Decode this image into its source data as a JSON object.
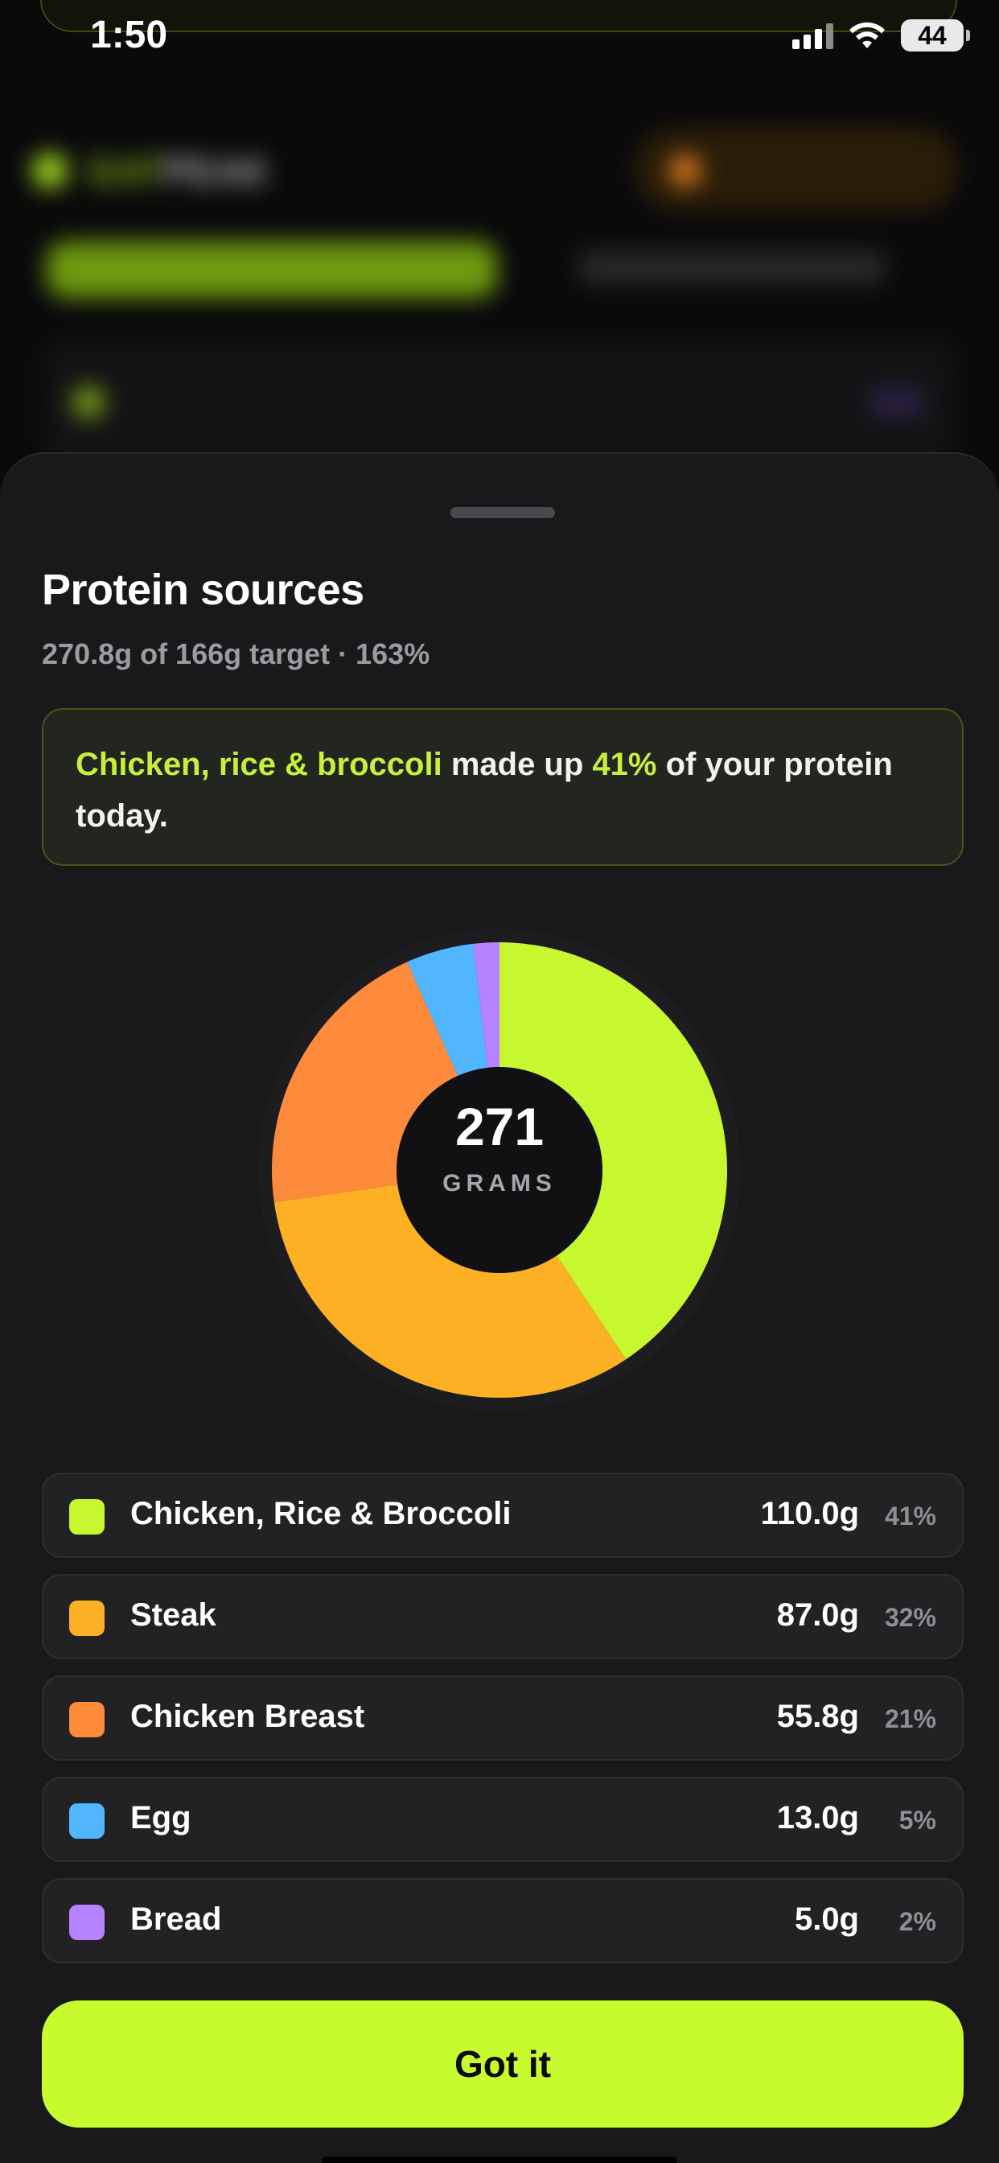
{
  "status_bar": {
    "time": "1:50",
    "battery": "44"
  },
  "background_app": {
    "logo_primary": "EAT",
    "logo_secondary": "PEAK"
  },
  "sheet": {
    "title": "Protein sources",
    "subtitle": "270.8g of 166g target · 163%",
    "insight": {
      "highlight_food": "Chicken, rice & broccoli",
      "text_mid": " made up ",
      "highlight_pct": "41%",
      "text_end": " of your protein today."
    },
    "donut": {
      "total": "271",
      "unit": "GRAMS"
    },
    "items": [
      {
        "name": "Chicken, Rice & Broccoli",
        "grams": "110.0g",
        "pct": "41%",
        "color": "#c6f72f"
      },
      {
        "name": "Steak",
        "grams": "87.0g",
        "pct": "32%",
        "color": "#fdb023"
      },
      {
        "name": "Chicken Breast",
        "grams": "55.8g",
        "pct": "21%",
        "color": "#fe8a3c"
      },
      {
        "name": "Egg",
        "grams": "13.0g",
        "pct": "5%",
        "color": "#52b6ff"
      },
      {
        "name": "Bread",
        "grams": "5.0g",
        "pct": "2%",
        "color": "#b782ff"
      }
    ],
    "button_label": "Got it"
  },
  "chart_data": {
    "type": "pie",
    "categories": [
      "Chicken, Rice & Broccoli",
      "Steak",
      "Chicken Breast",
      "Egg",
      "Bread"
    ],
    "values": [
      110.0,
      87.0,
      55.8,
      13.0,
      5.0
    ],
    "colors": [
      "#c6f72f",
      "#fdb023",
      "#fe8a3c",
      "#52b6ff",
      "#b782ff"
    ],
    "total": 271
  }
}
